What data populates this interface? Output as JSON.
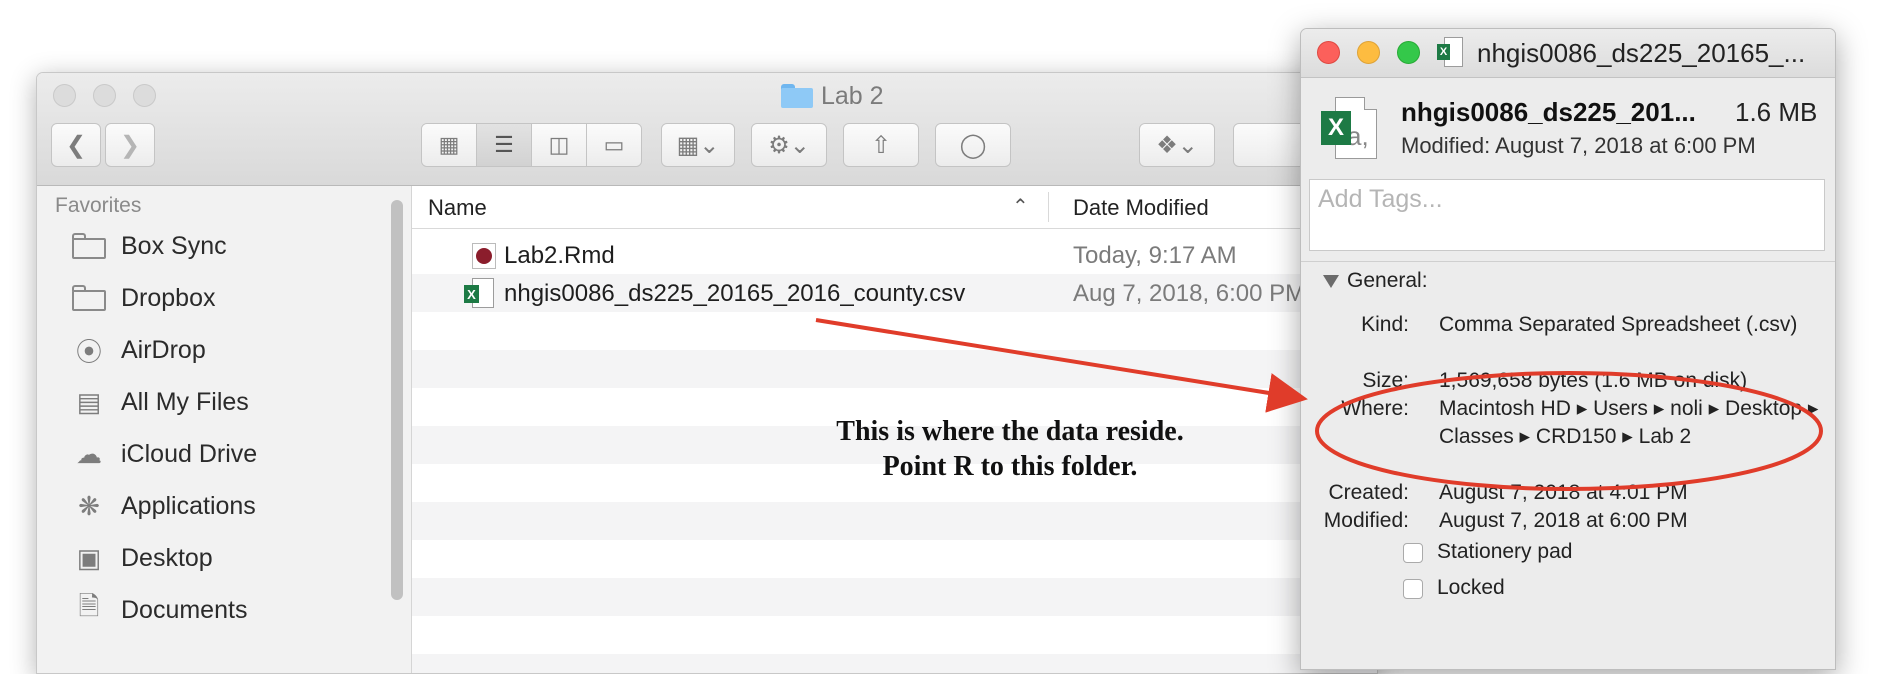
{
  "finder": {
    "title": "Lab 2",
    "sidebar": {
      "heading": "Favorites",
      "items": [
        {
          "label": "Box Sync",
          "icon": "folder-icon"
        },
        {
          "label": "Dropbox",
          "icon": "folder-icon"
        },
        {
          "label": "AirDrop",
          "icon": "airdrop-icon"
        },
        {
          "label": "All My Files",
          "icon": "all-files-icon"
        },
        {
          "label": "iCloud Drive",
          "icon": "cloud-icon"
        },
        {
          "label": "Applications",
          "icon": "applications-icon"
        },
        {
          "label": "Desktop",
          "icon": "desktop-icon"
        },
        {
          "label": "Documents",
          "icon": "documents-icon"
        }
      ]
    },
    "columns": {
      "name": "Name",
      "date": "Date Modified"
    },
    "files": [
      {
        "name": "Lab2.Rmd",
        "date": "Today, 9:17 AM",
        "icon": "rmd-file-icon"
      },
      {
        "name": "nhgis0086_ds225_20165_2016_county.csv",
        "date": "Aug 7, 2018, 6:00 PM",
        "icon": "excel-file-icon"
      }
    ]
  },
  "info": {
    "window_title": "nhgis0086_ds225_20165_...",
    "file_name": "nhgis0086_ds225_201...",
    "file_size": "1.6 MB",
    "modified_line": "Modified:  August 7, 2018 at 6:00 PM",
    "tags_placeholder": "Add Tags...",
    "general_label": "General:",
    "general": {
      "kind_label": "Kind:",
      "kind_value": "Comma Separated Spreadsheet (.csv)",
      "size_label": "Size:",
      "size_value": "1,569,658 bytes (1.6 MB on disk)",
      "where_label": "Where:",
      "where_value": "Macintosh HD ▸ Users ▸ noli ▸ Desktop ▸ Classes ▸ CRD150 ▸ Lab 2",
      "created_label": "Created:",
      "created_value": "August 7, 2018 at 4:01 PM",
      "modified_label": "Modified:",
      "modified_value": "August 7, 2018 at 6:00 PM",
      "stationery_label": "Stationery pad",
      "stationery_checked": false,
      "locked_label": "Locked",
      "locked_checked": false
    }
  },
  "annotation": {
    "line1": "This is where the data reside.",
    "line2": "Point R to this folder.",
    "color": "#e03c2a"
  }
}
